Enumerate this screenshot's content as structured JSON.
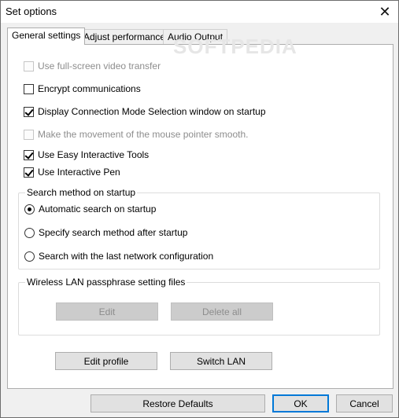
{
  "window": {
    "title": "Set options"
  },
  "tabs": [
    {
      "label": "General settings",
      "active": true
    },
    {
      "label": "Adjust performance",
      "active": false
    },
    {
      "label": "Audio Output",
      "active": false
    }
  ],
  "options": [
    {
      "label": "Use full-screen video transfer",
      "checked": false,
      "enabled": false
    },
    {
      "label": "Encrypt communications",
      "checked": false,
      "enabled": true
    },
    {
      "label": "Display Connection Mode Selection window on startup",
      "checked": true,
      "enabled": true
    },
    {
      "label": "Make the movement of the mouse pointer smooth.",
      "checked": false,
      "enabled": false
    },
    {
      "label": "Use Easy Interactive Tools",
      "checked": true,
      "enabled": true
    },
    {
      "label": "Use Interactive Pen",
      "checked": true,
      "enabled": true
    }
  ],
  "search_group": {
    "label": "Search method on startup",
    "radios": [
      {
        "label": "Automatic search on startup",
        "selected": true
      },
      {
        "label": "Specify search method after startup",
        "selected": false
      },
      {
        "label": "Search with the last network configuration",
        "selected": false
      }
    ]
  },
  "wireless_group": {
    "label": "Wireless LAN passphrase setting files",
    "edit_label": "Edit",
    "delete_all_label": "Delete all"
  },
  "panel_buttons": {
    "edit_profile": "Edit profile",
    "switch_lan": "Switch LAN"
  },
  "footer": {
    "restore_defaults": "Restore Defaults",
    "ok": "OK",
    "cancel": "Cancel"
  },
  "watermark": "SOFTPEDIA",
  "colors": {
    "accent": "#0078d7",
    "disabled_text": "#8d8d8d"
  }
}
